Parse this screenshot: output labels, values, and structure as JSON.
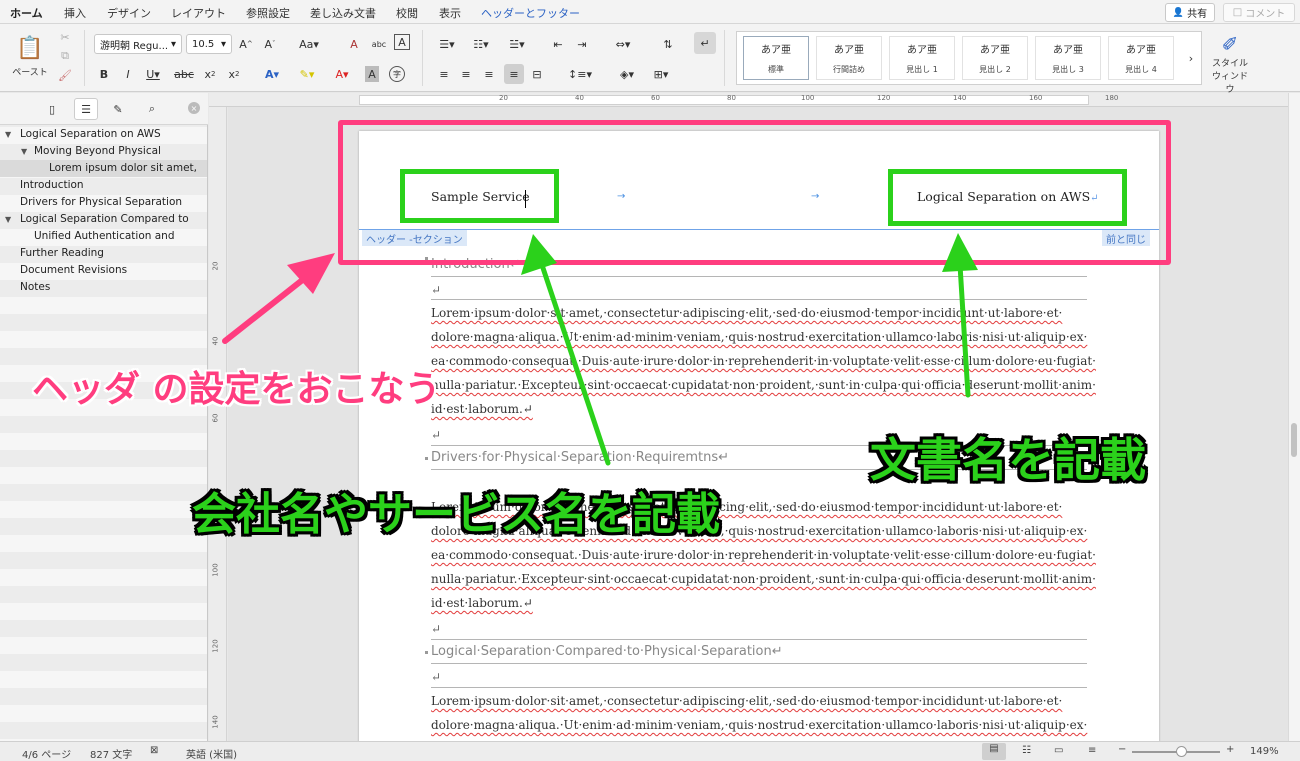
{
  "tabs": [
    "ホーム",
    "挿入",
    "デザイン",
    "レイアウト",
    "参照設定",
    "差し込み文書",
    "校閲",
    "表示",
    "ヘッダーとフッター"
  ],
  "share_label": "共有",
  "comment_label": "コメント",
  "ribbon": {
    "paste_label": "ペースト",
    "font_name": "游明朝 Regu...",
    "font_size": "10.5",
    "styles": [
      {
        "preview": "あア亜",
        "name": "標準"
      },
      {
        "preview": "あア亜",
        "name": "行間詰め"
      },
      {
        "preview": "あア亜",
        "name": "見出し 1"
      },
      {
        "preview": "あア亜",
        "name": "見出し 2"
      },
      {
        "preview": "あア亜",
        "name": "見出し 3"
      },
      {
        "preview": "あア亜",
        "name": "見出し 4"
      }
    ],
    "style_window_label_1": "スタイル",
    "style_window_label_2": "ウィンドウ"
  },
  "nav_pane": {
    "items": [
      {
        "label": "Logical Separation on AWS",
        "level": 0,
        "expanded": true
      },
      {
        "label": "Moving Beyond Physical",
        "level": 1,
        "expanded": true
      },
      {
        "label": "Lorem ipsum dolor sit amet,",
        "level": 2,
        "selected": true
      },
      {
        "label": "Introduction",
        "level": 0
      },
      {
        "label": "Drivers for Physical Separation",
        "level": 0
      },
      {
        "label": "Logical Separation Compared to",
        "level": 0,
        "expanded": true
      },
      {
        "label": "Unified Authentication and",
        "level": 1
      },
      {
        "label": "Further Reading",
        "level": 0
      },
      {
        "label": "Document Revisions",
        "level": 0
      },
      {
        "label": "Notes",
        "level": 0
      }
    ]
  },
  "ruler": {
    "h_ticks": [
      "20",
      "40",
      "60",
      "80",
      "100",
      "120",
      "140",
      "160",
      "180"
    ],
    "v_ticks": [
      "20",
      "40",
      "60",
      "80",
      "100",
      "120",
      "140"
    ]
  },
  "document": {
    "header_left": "Sample Service",
    "header_right": "Logical Separation on AWS",
    "header_section_tag": "ヘッダー -セクション",
    "same_as_previous": "前と同じ",
    "heading_1": "Introduction↵",
    "heading_2": "Drivers·for·Physical·Separation·Requiremtns↵",
    "heading_3": "Logical·Separation·Compared·to·Physical·Separation↵",
    "para_lines": [
      "Lorem·ipsum·dolor·sit·amet,·consectetur·adipiscing·elit,·sed·do·eiusmod·tempor·incididunt·ut·labore·et·",
      "dolore·magna·aliqua.·Ut·enim·ad·minim·veniam,·quis·nostrud·exercitation·ullamco·laboris·nisi·ut·aliquip·ex·",
      "ea·commodo·consequat.·Duis·aute·irure·dolor·in·reprehenderit·in·voluptate·velit·esse·cillum·dolore·eu·fugiat·",
      "nulla·pariatur.·Excepteur·sint·occaecat·cupidatat·non·proident,·sunt·in·culpa·qui·officia·deserunt·mollit·anim·",
      "id·est·laborum.↵"
    ],
    "empty_mark": "↵"
  },
  "annotations": {
    "header_setting": "ヘッダ の設定をおこなう",
    "company_name": "会社名やサービス名を記載",
    "doc_name": "文書名を記載"
  },
  "status": {
    "page": "4/6 ページ",
    "words": "827 文字",
    "language": "英語 (米国)",
    "zoom": "149%"
  },
  "colors": {
    "pink": "#ff3d7f",
    "green": "#2bd11b",
    "word_blue": "#2b579a"
  }
}
